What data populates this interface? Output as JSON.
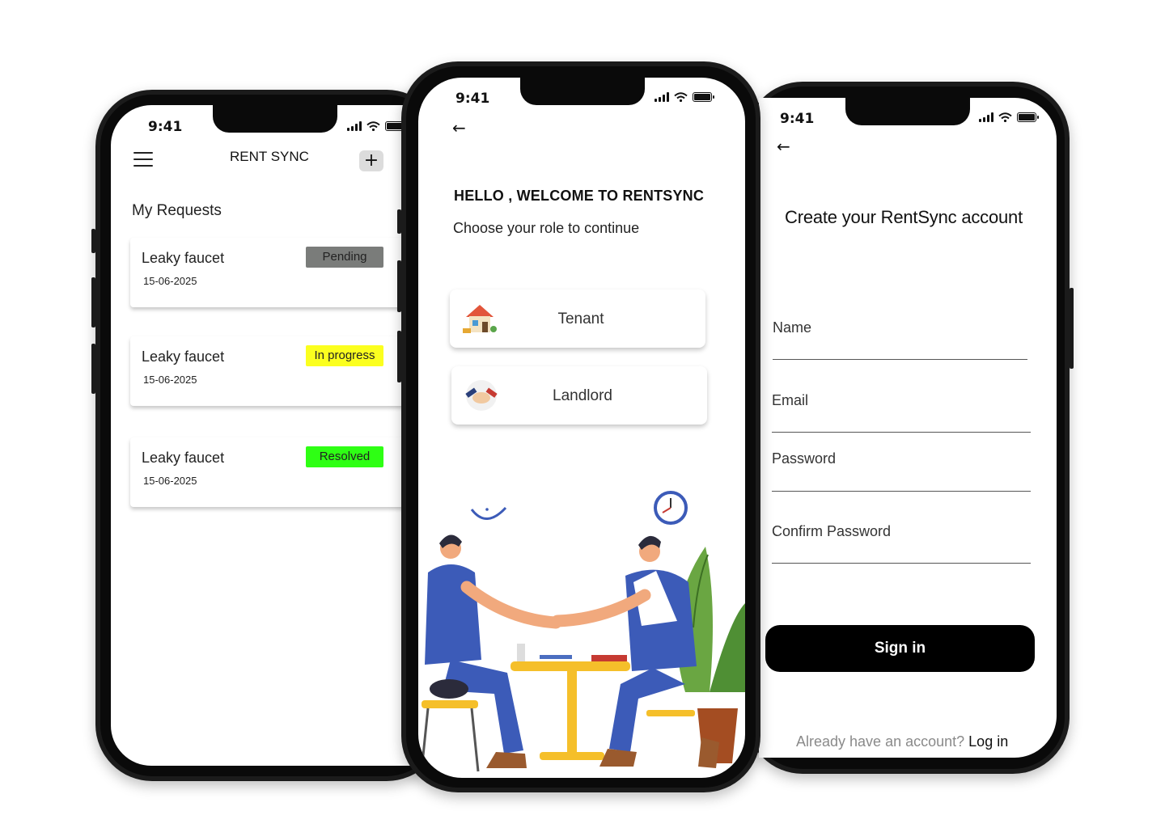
{
  "status_bar": {
    "time": "9:41"
  },
  "requests_screen": {
    "app_title": "RENT SYNC",
    "add_label": "+",
    "section_title": "My Requests",
    "requests": [
      {
        "title": "Leaky faucet",
        "date": "15-06-2025",
        "status": "Pending",
        "status_color": "#7a7c7a"
      },
      {
        "title": "Leaky faucet",
        "date": "15-06-2025",
        "status": "In progress",
        "status_color": "#fbff1f"
      },
      {
        "title": "Leaky faucet",
        "date": "15-06-2025",
        "status": "Resolved",
        "status_color": "#2eff14"
      }
    ]
  },
  "role_screen": {
    "back_icon": "←",
    "title": "HELLO , WELCOME TO RENTSYNC",
    "subtitle": "Choose your role to continue",
    "roles": [
      {
        "label": "Tenant",
        "icon": "house-icon"
      },
      {
        "label": "Landlord",
        "icon": "handshake-icon"
      }
    ],
    "illustration": "handshake-illustration"
  },
  "signup_screen": {
    "back_icon": "←",
    "title": "Create your RentSync account",
    "fields": [
      {
        "label": "Name"
      },
      {
        "label": "Email"
      },
      {
        "label": "Password"
      },
      {
        "label": "Confirm Password"
      }
    ],
    "submit_label": "Sign in",
    "footer_prompt": "Already have an account?",
    "footer_link": "Log in"
  },
  "colors": {
    "primary_button": "#000000",
    "frame": "#1b1b1b"
  }
}
